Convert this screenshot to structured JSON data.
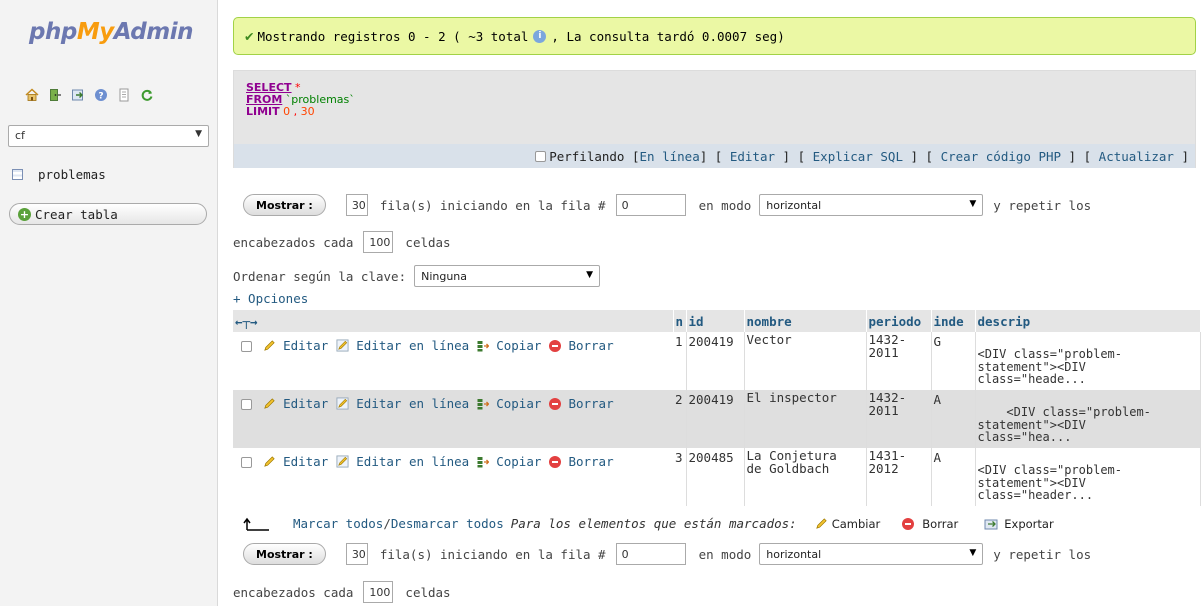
{
  "nav": {
    "logo": {
      "part1": "php",
      "part2": "My",
      "part3": "Admin"
    },
    "icons": [
      "home-icon",
      "exit-icon",
      "query-window-icon",
      "docs-icon",
      "mysql-docs-icon",
      "reload-icon"
    ],
    "db_select": "cf",
    "table_item": "problemas",
    "create_table": "Crear tabla"
  },
  "success": {
    "text_before": "Mostrando registros 0 - 2 ( ~3 total",
    "text_after": ", La consulta tardó 0.0007 seg)"
  },
  "sql": {
    "select_kw": "SELECT",
    "star": "*",
    "from_kw": "FROM",
    "table": "`problemas`",
    "limit_kw": "LIMIT",
    "offset": "0",
    "comma": ",",
    "count": "30",
    "tools": {
      "profiling": "Perfilando",
      "inline": "En línea",
      "edit": "Editar",
      "explain": "Explicar SQL",
      "php": "Crear código PHP",
      "refresh": "Actualizar"
    }
  },
  "nav_form": {
    "show_button": "Mostrar :",
    "rows": "30",
    "rows_label": "fila(s) iniciando en la fila #",
    "start": "0",
    "mode_label": "en modo",
    "mode": "horizontal",
    "repeat_label": "y repetir los",
    "headers_label": "encabezados cada",
    "repeat_every": "100",
    "cells_label": "celdas"
  },
  "sort": {
    "label": "Ordenar según la clave:",
    "value": "Ninguna"
  },
  "options_link": "+ Opciones",
  "table": {
    "headers": [
      "n",
      "id",
      "nombre",
      "periodo",
      "inde",
      "descrip"
    ],
    "action_labels": {
      "edit": "Editar",
      "inline": "Editar en línea",
      "copy": "Copiar",
      "delete": "Borrar"
    },
    "rows": [
      {
        "n": "1",
        "id": "200419",
        "nombre": "Vector",
        "periodo": "1432-\n2011",
        "inde": "G",
        "descrip": "<DIV class=\"problem-\nstatement\"><DIV\nclass=\"heade..."
      },
      {
        "n": "2",
        "id": "200419",
        "nombre": "El inspector",
        "periodo": "1432-\n2011",
        "inde": "A",
        "descrip": "    <DIV class=\"problem-\nstatement\"><DIV\nclass=\"hea..."
      },
      {
        "n": "3",
        "id": "200485",
        "nombre": "La Conjetura\nde Goldbach",
        "periodo": "1431-\n2012",
        "inde": "A",
        "descrip": "<DIV class=\"problem-\nstatement\"><DIV\nclass=\"header..."
      }
    ]
  },
  "bulk": {
    "check_all": "Marcar todos",
    "separator": " / ",
    "uncheck_all": "Desmarcar todos",
    "with_selected": "Para los elementos que están marcados:",
    "change": "Cambiar",
    "delete": "Borrar",
    "export": "Exportar"
  }
}
